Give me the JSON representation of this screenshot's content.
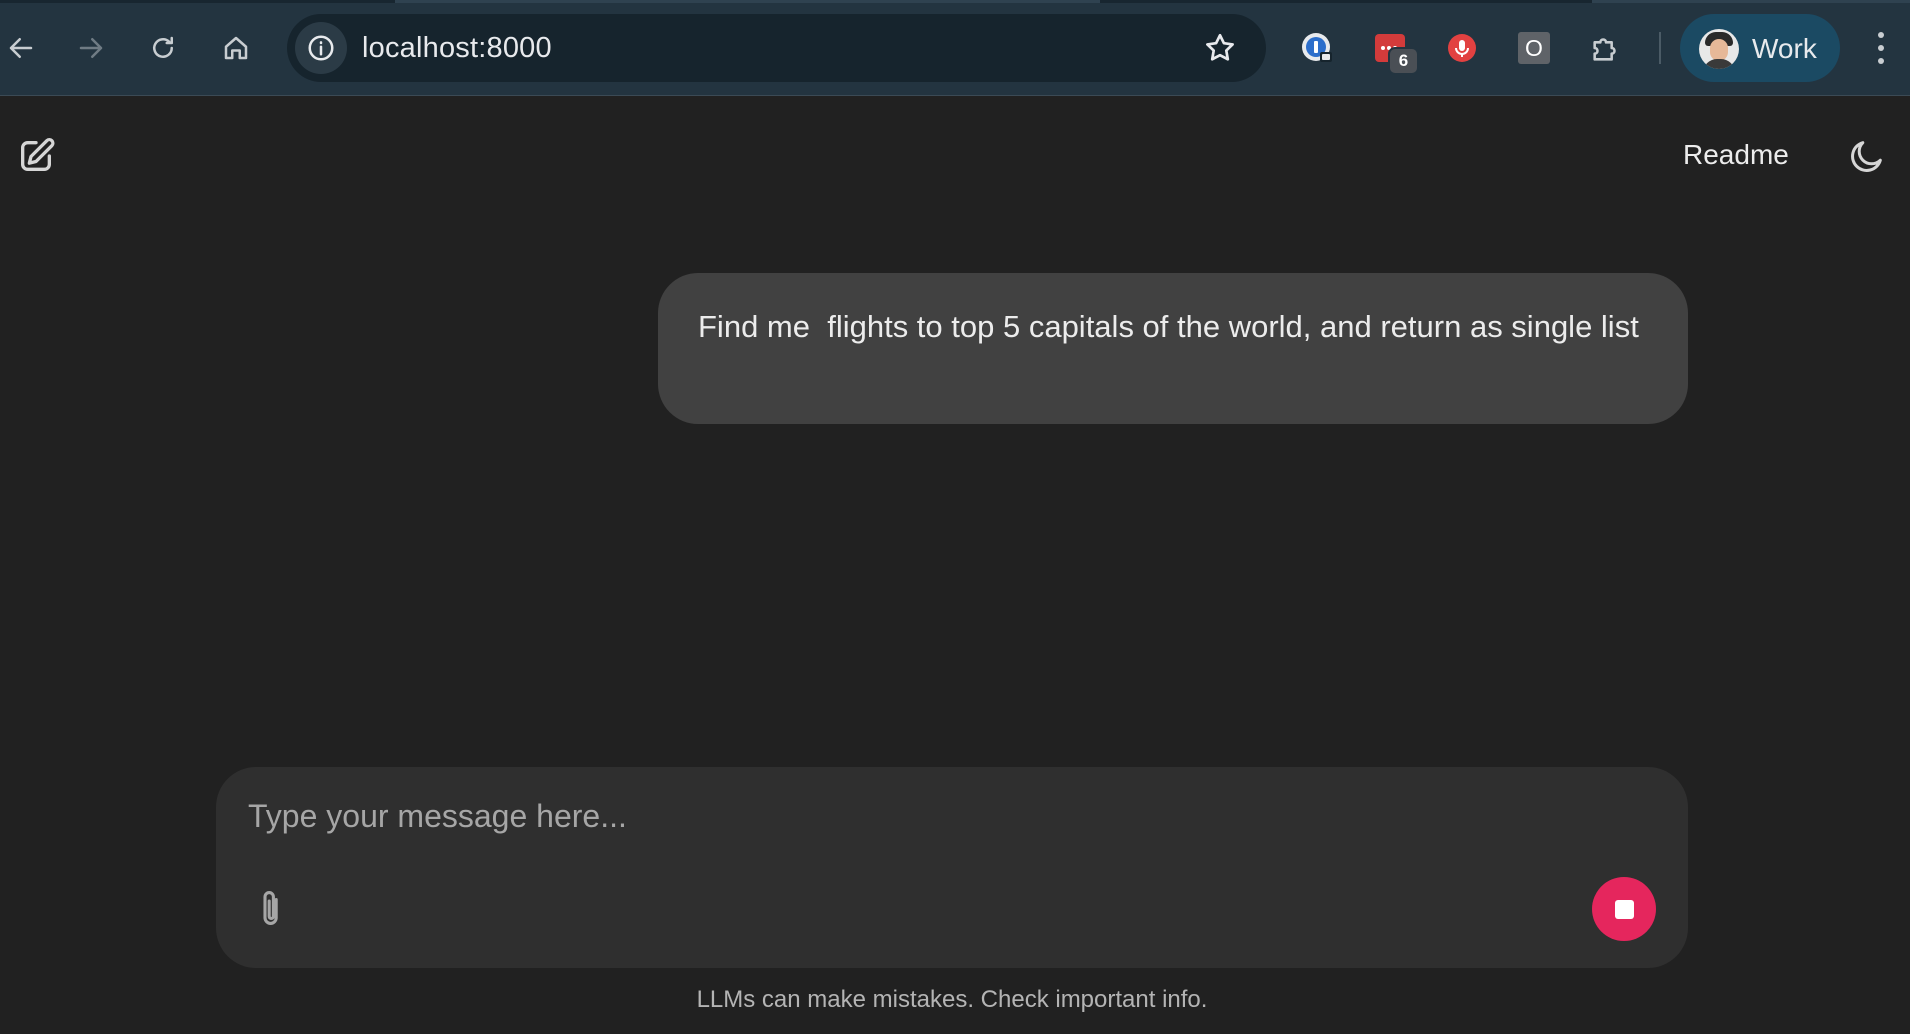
{
  "browser": {
    "url": "localhost:8000",
    "profile_label": "Work",
    "extension_badge": "6",
    "opera_ext_letter": "O",
    "icons": {
      "back": "arrow-left-icon",
      "forward": "arrow-right-icon",
      "reload": "reload-icon",
      "home": "home-icon",
      "site_info": "info-icon",
      "bookmark": "star-icon",
      "extensions": "puzzle-icon",
      "menu": "kebab-menu-icon"
    }
  },
  "app": {
    "header": {
      "readme_label": "Readme",
      "new_chat_icon": "edit-square-icon",
      "theme_icon": "moon-icon"
    },
    "messages": [
      {
        "role": "user",
        "text": "Find me  flights to top 5 capitals of the world, and return as single list"
      }
    ],
    "composer": {
      "placeholder": "Type your message here...",
      "value": "",
      "attach_icon": "paperclip-icon",
      "stop_icon": "stop-icon"
    },
    "disclaimer": "LLMs can make mistakes. Check important info."
  },
  "colors": {
    "chrome_bg": "#233440",
    "omnibox_bg": "#16242d",
    "profile_bg": "#1b4a63",
    "app_bg": "#212121",
    "bubble_bg": "#414141",
    "composer_bg": "#2f2f2f",
    "stop_button": "#e5265d"
  }
}
